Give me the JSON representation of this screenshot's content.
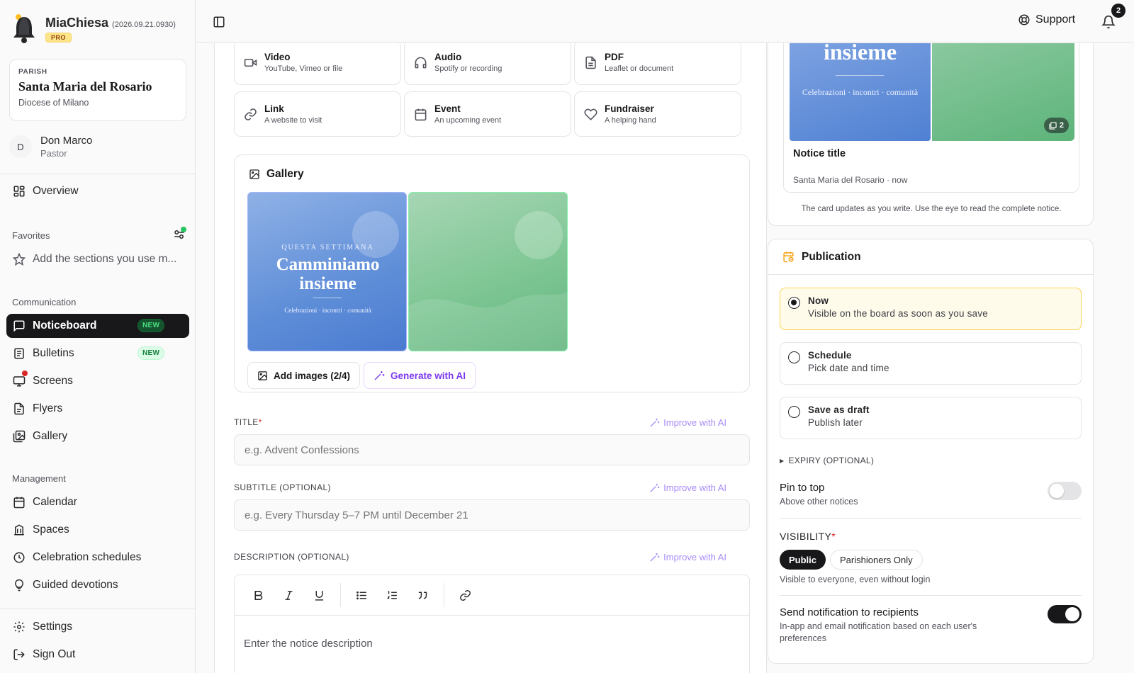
{
  "brand": {
    "name": "MiaChiesa",
    "version": "(2026.09.21.0930)",
    "tier": "PRO"
  },
  "parish": {
    "kicker": "PARISH",
    "name": "Santa Maria del Rosario",
    "diocese": "Diocese of Milano"
  },
  "user": {
    "initial": "D",
    "name": "Don Marco",
    "role": "Pastor"
  },
  "nav": {
    "overview": "Overview",
    "favorites_label": "Favorites",
    "favorites_hint": "Add the sections you use m...",
    "communication_label": "Communication",
    "noticeboard": "Noticeboard",
    "bulletins": "Bulletins",
    "screens": "Screens",
    "flyers": "Flyers",
    "gallery": "Gallery",
    "new_badge": "NEW",
    "management_label": "Management",
    "calendar": "Calendar",
    "spaces": "Spaces",
    "celebrations": "Celebration schedules",
    "devotions": "Guided devotions",
    "settings": "Settings",
    "signout": "Sign Out"
  },
  "topbar": {
    "support": "Support",
    "notif_count": "2"
  },
  "types": [
    {
      "title": "Video",
      "sub": "YouTube, Vimeo or file"
    },
    {
      "title": "Audio",
      "sub": "Spotify or recording"
    },
    {
      "title": "PDF",
      "sub": "Leaflet or document"
    },
    {
      "title": "Link",
      "sub": "A website to visit"
    },
    {
      "title": "Event",
      "sub": "An upcoming event"
    },
    {
      "title": "Fundraiser",
      "sub": "A helping hand"
    }
  ],
  "gallery": {
    "title": "Gallery",
    "slide": {
      "kicker": "QUESTA SETTIMANA",
      "line1": "Camminiamo",
      "line2": "insieme",
      "tagline": "Celebrazioni · incontri · comunità"
    },
    "add_label": "Add images (2/4)",
    "ai_label": "Generate with AI"
  },
  "form": {
    "title_label": "TITLE",
    "title_placeholder": "e.g. Advent Confessions",
    "subtitle_label": "SUBTITLE (OPTIONAL)",
    "subtitle_placeholder": "e.g. Every Thursday 5–7 PM until December 21",
    "desc_label": "DESCRIPTION (OPTIONAL)",
    "desc_placeholder": "Enter the notice description",
    "improve": "Improve with AI",
    "required_mark": "*"
  },
  "preview": {
    "slide_word": "insieme",
    "slide_tagline": "Celebrazioni · incontri · comunità",
    "count": "2",
    "title": "Notice title",
    "meta": "Santa Maria del Rosario · now",
    "hint": "The card updates as you write. Use the eye to read the complete notice."
  },
  "publication": {
    "title": "Publication",
    "options": [
      {
        "title": "Now",
        "sub": "Visible on the board as soon as you save"
      },
      {
        "title": "Schedule",
        "sub": "Pick date and time"
      },
      {
        "title": "Save as draft",
        "sub": "Publish later"
      }
    ],
    "expiry": "EXPIRY (OPTIONAL)",
    "pin_title": "Pin to top",
    "pin_sub": "Above other notices",
    "visibility_label": "VISIBILITY",
    "vis_public": "Public",
    "vis_parish": "Parishioners Only",
    "vis_hint": "Visible to everyone, even without login",
    "notify_title": "Send notification to recipients",
    "notify_sub": "In-app and email notification based on each user's preferences"
  },
  "colors": {
    "accent": "#18181b",
    "ai": "#7c3aed",
    "selected_bg": "#fffbeb",
    "success": "#16a34a"
  }
}
